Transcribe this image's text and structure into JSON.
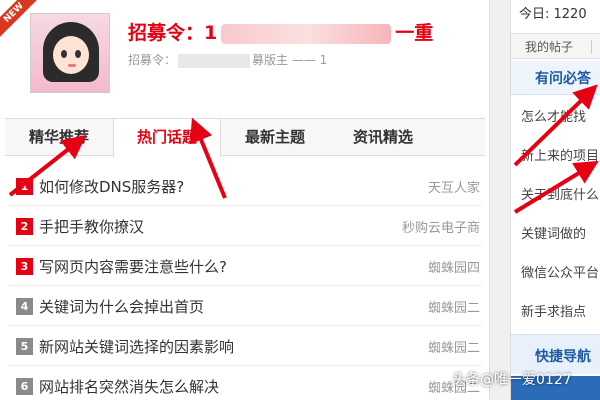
{
  "header": {
    "badge": "NEW",
    "title_prefix": "招募令：",
    "title_visible_fragment_start": "1",
    "title_visible_fragment_end": "一重",
    "subline_prefix": "招募令：",
    "subline_suffix": "募版主 —— 1"
  },
  "tabs": [
    {
      "label": "精华推荐"
    },
    {
      "label": "热门话题"
    },
    {
      "label": "最新主题"
    },
    {
      "label": "资讯精选"
    }
  ],
  "topics": [
    {
      "num": "1",
      "title": "如何修改DNS服务器?",
      "source": "天互人家"
    },
    {
      "num": "2",
      "title": "手把手教你撩汉",
      "source": "秒购云电子商"
    },
    {
      "num": "3",
      "title": "写网页内容需要注意些什么?",
      "source": "蜘蛛园四"
    },
    {
      "num": "4",
      "title": "关键词为什么会掉出首页",
      "source": "蜘蛛园二"
    },
    {
      "num": "5",
      "title": "新网站关键词选择的因素影响",
      "source": "蜘蛛园二"
    },
    {
      "num": "6",
      "title": "网站排名突然消失怎么解决",
      "source": "蜘蛛园二"
    }
  ],
  "sidebar": {
    "today": "今日: 1220",
    "my_posts": "我的帖子",
    "qa_heading": "有问必答",
    "qa_items": [
      {
        "label": "怎么才能找"
      },
      {
        "label": "新上来的项目"
      },
      {
        "label": "关于到底什么"
      },
      {
        "label": "关键词做的"
      },
      {
        "label": "微信公众平台"
      },
      {
        "label": "新手求指点"
      }
    ],
    "quick_nav": "快捷导航"
  },
  "watermark": "头条@唯一爱0127",
  "colors": {
    "accent_red": "#e60012",
    "link_blue": "#1f5aa6"
  }
}
